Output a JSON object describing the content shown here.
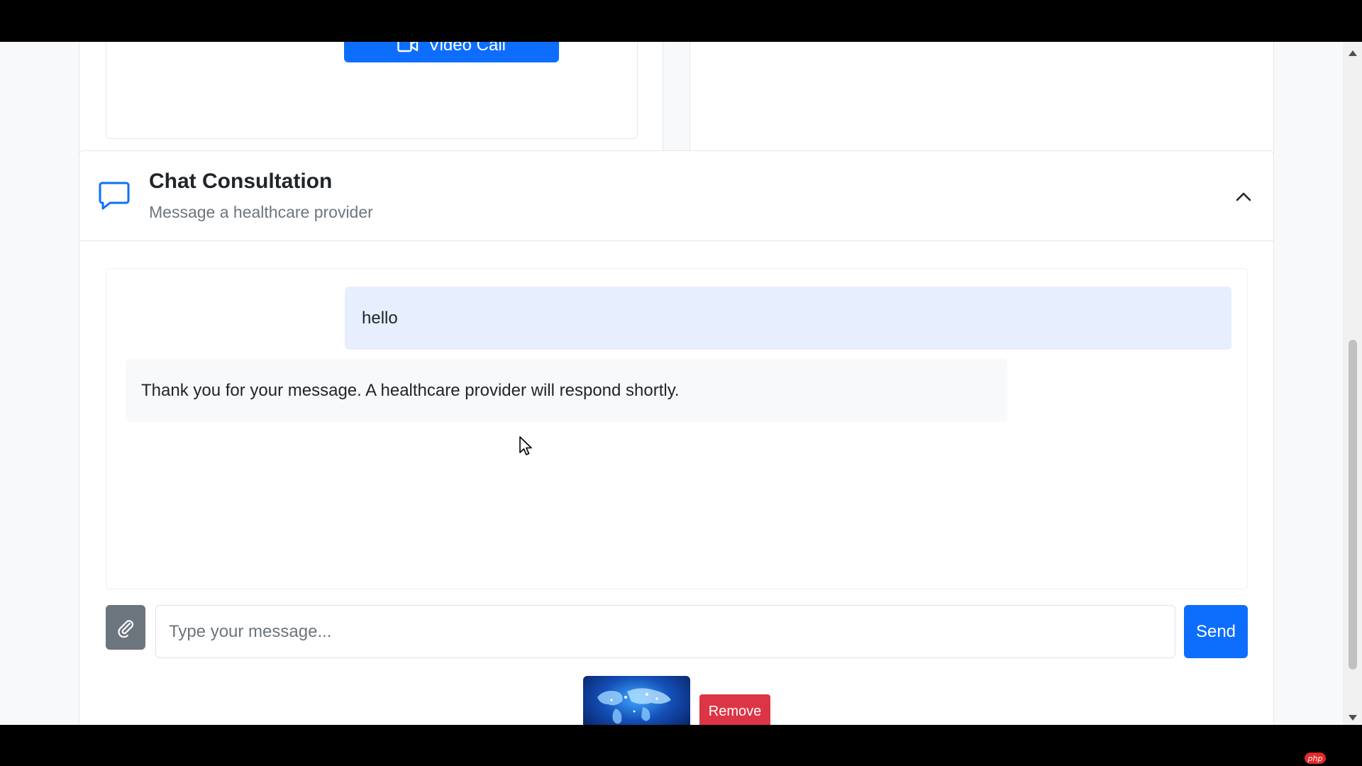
{
  "top_cards": {
    "video_call_label": "Video Call"
  },
  "chat": {
    "title": "Chat Consultation",
    "subtitle": "Message a healthcare provider",
    "messages": [
      {
        "sender": "user",
        "text": "hello"
      },
      {
        "sender": "provider",
        "text": "Thank you for your message. A healthcare provider will respond shortly."
      }
    ],
    "composer": {
      "placeholder": "Type your message...",
      "value": "",
      "send_label": "Send"
    },
    "attachment": {
      "remove_label": "Remove"
    }
  },
  "watermark": {
    "label": "php"
  },
  "colors": {
    "primary": "#0d6efd",
    "danger": "#dc3545",
    "secondary": "#6c757d",
    "user_bubble": "#e7eefe",
    "bot_bubble": "#f8f9fa"
  },
  "icons": {
    "video_call": "video-camera-icon",
    "chat": "chat-bubble-icon",
    "collapse": "chevron-up-icon",
    "attach": "paperclip-icon"
  }
}
